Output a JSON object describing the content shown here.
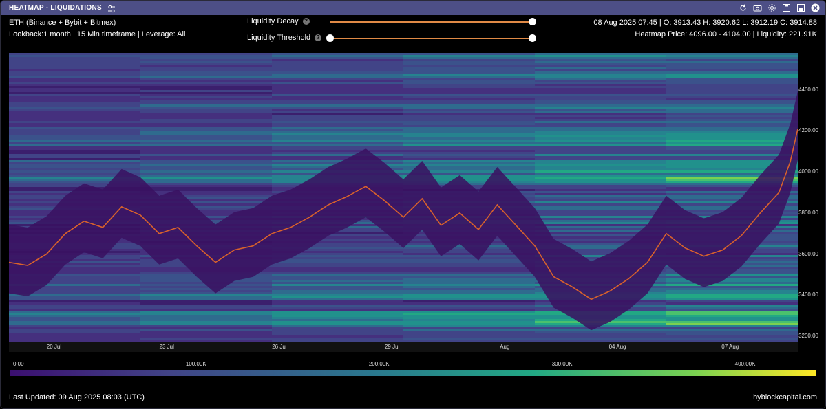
{
  "window": {
    "title": "HEATMAP - LIQUIDATIONS",
    "icons": [
      "refresh-icon",
      "camera-icon",
      "gear-icon",
      "save-icon",
      "expand-icon",
      "close-icon"
    ]
  },
  "info": {
    "asset": "ETH (Binance + Bybit + Bitmex)",
    "lookback": "Lookback:1 month | 15 Min timeframe | Leverage: All",
    "ohlc": "08 Aug 2025 07:45 | O: 3913.43 H: 3920.62 L: 3912.19 C: 3914.88",
    "heatmap_price": "Heatmap Price: 4096.00 - 4104.00 | Liquidity: 221.91K"
  },
  "controls": {
    "decay_label": "Liquidity Decay",
    "threshold_label": "Liquidity Threshold",
    "help": "?",
    "decay_value": 1.0,
    "threshold_range": [
      0.0,
      1.0
    ]
  },
  "chart_data": {
    "type": "heatmap",
    "price_ticks": [
      "4400.00",
      "4200.00",
      "4000.00",
      "3800.00",
      "3600.00",
      "3400.00",
      "3200.00"
    ],
    "price_tick_values": [
      4400,
      4200,
      4000,
      3800,
      3600,
      3400,
      3200
    ],
    "ylim": [
      3170,
      4580
    ],
    "date_ticks": [
      "20 Jul",
      "23 Jul",
      "26 Jul",
      "29 Jul",
      "Aug",
      "04 Aug",
      "07 Aug"
    ],
    "date_tick_days": [
      1.2,
      4.2,
      7.2,
      10.2,
      13.2,
      16.2,
      19.2
    ],
    "xlim_days": [
      0,
      21
    ],
    "price_path": [
      [
        0,
        3560
      ],
      [
        0.5,
        3545
      ],
      [
        1,
        3600
      ],
      [
        1.5,
        3700
      ],
      [
        2,
        3760
      ],
      [
        2.5,
        3730
      ],
      [
        3,
        3830
      ],
      [
        3.5,
        3790
      ],
      [
        4,
        3700
      ],
      [
        4.5,
        3730
      ],
      [
        5,
        3640
      ],
      [
        5.5,
        3560
      ],
      [
        6,
        3620
      ],
      [
        6.5,
        3640
      ],
      [
        7,
        3700
      ],
      [
        7.5,
        3730
      ],
      [
        8,
        3780
      ],
      [
        8.5,
        3840
      ],
      [
        9,
        3880
      ],
      [
        9.5,
        3930
      ],
      [
        10,
        3860
      ],
      [
        10.5,
        3780
      ],
      [
        11,
        3870
      ],
      [
        11.5,
        3740
      ],
      [
        12,
        3800
      ],
      [
        12.5,
        3720
      ],
      [
        13,
        3840
      ],
      [
        13.5,
        3740
      ],
      [
        14,
        3640
      ],
      [
        14.5,
        3490
      ],
      [
        15,
        3440
      ],
      [
        15.5,
        3380
      ],
      [
        16,
        3420
      ],
      [
        16.5,
        3480
      ],
      [
        17,
        3560
      ],
      [
        17.5,
        3700
      ],
      [
        18,
        3630
      ],
      [
        18.5,
        3590
      ],
      [
        19,
        3620
      ],
      [
        19.5,
        3690
      ],
      [
        20,
        3800
      ],
      [
        20.5,
        3900
      ],
      [
        20.8,
        4050
      ],
      [
        21,
        4210
      ]
    ],
    "colorbar": {
      "labels": [
        "0.00",
        "100.00K",
        "200.00K",
        "300.00K",
        "400.00K"
      ],
      "values": [
        0,
        100000,
        200000,
        300000,
        400000
      ],
      "max": 440000
    }
  },
  "footer": {
    "last_updated": "Last Updated: 09 Aug 2025 08:03 (UTC)",
    "brand": "hyblockcapital.com"
  }
}
